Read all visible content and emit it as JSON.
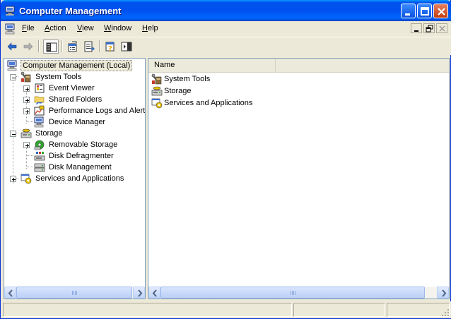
{
  "window": {
    "title": "Computer Management"
  },
  "menu": {
    "items": [
      {
        "label": "File",
        "accel": "F",
        "rest": "ile"
      },
      {
        "label": "Action",
        "accel": "A",
        "rest": "ction"
      },
      {
        "label": "View",
        "accel": "V",
        "rest": "iew"
      },
      {
        "label": "Window",
        "accel": "W",
        "rest": "indow"
      },
      {
        "label": "Help",
        "accel": "H",
        "rest": "elp"
      }
    ]
  },
  "toolbar": {
    "buttons": [
      "back-icon",
      "forward-icon",
      "show-hide-tree-icon",
      "properties-icon",
      "export-list-icon",
      "help-icon",
      "show-hide-action-pane-icon"
    ]
  },
  "tree": {
    "root": "Computer Management (Local)",
    "system_tools": "System Tools",
    "event_viewer": "Event Viewer",
    "shared_folders": "Shared Folders",
    "performance_logs": "Performance Logs and Alerts",
    "device_manager": "Device Manager",
    "storage": "Storage",
    "removable_storage": "Removable Storage",
    "disk_defragmenter": "Disk Defragmenter",
    "disk_management": "Disk Management",
    "services_apps": "Services and Applications"
  },
  "list": {
    "column_name": "Name",
    "items": [
      "System Tools",
      "Storage",
      "Services and Applications"
    ]
  },
  "colors": {
    "title_bar": "#0053ee",
    "window_bg": "#ece9d8",
    "pane_border": "#7f9db9"
  }
}
